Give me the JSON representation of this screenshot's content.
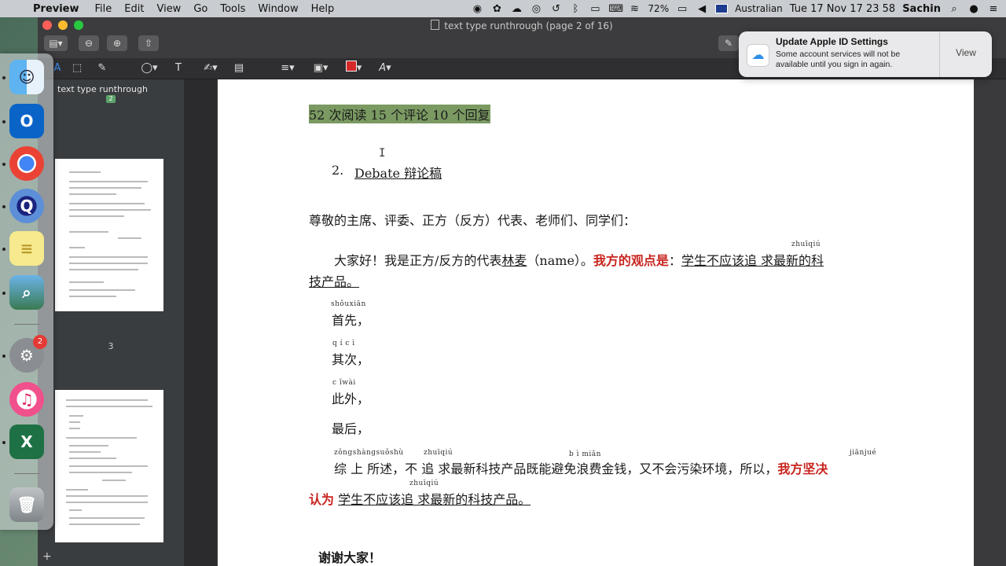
{
  "menubar": {
    "app": "Preview",
    "menus": [
      "File",
      "Edit",
      "View",
      "Go",
      "Tools",
      "Window",
      "Help"
    ],
    "battery": "72%",
    "input_source": "Australian",
    "clock": "Tue 17 Nov  17 23 58",
    "user": "Sachin"
  },
  "window": {
    "title": "text type runthrough (page 2 of 16)"
  },
  "sidebar": {
    "title": "text type runthrough",
    "badge": "2",
    "thumb_label": "3"
  },
  "notification": {
    "title": "Update Apple ID Settings",
    "body": "Some account services will not be available until you sign in again.",
    "action": "View"
  },
  "dock": {
    "settings_badge": "2"
  },
  "document": {
    "stats": "52 次阅读  15 个评论 10 个回复",
    "heading_num": "2.",
    "heading": "Debate 辩论稿",
    "salutation": "尊敬的主席、评委、正方（反方）代表、老师们、同学们：",
    "intro_a": "大家好！我是正方/反方的代表",
    "intro_name": "林麦",
    "intro_b": "（name）。",
    "intro_red": "我方的观点是",
    "intro_colon": "：",
    "intro_claim": "学生不应该追 求最新的科",
    "intro_claim2": "技产品。",
    "pinyin_zhuiqiu": "zhuīqiú",
    "pinyin_shouxian": "shǒuxiān",
    "first": "首先，",
    "pinyin_qici": "q í c ì",
    "second": "其次，",
    "pinyin_ciwai": "c ǐwài",
    "besides": "此外，",
    "last": "最后，",
    "pinyin_zongshang": "zǒngshàngsuǒshù",
    "pinyin_zhuiqiu2": "zhuīqiú",
    "pinyin_bimian": "b ì miǎn",
    "pinyin_jianjue": "jiānjué",
    "conclusion": "综 上 所述，不 追 求最新科技产品既能避免浪费金钱，又不会污染环境，所以，",
    "conclusion_red": "我方坚决",
    "conclusion_red2": "认为",
    "pinyin_zhuiqiu3": "zhuīqiú",
    "conclusion_claim": "学生不应该追 求最新的科技产品。",
    "thanks": "谢谢大家！"
  }
}
